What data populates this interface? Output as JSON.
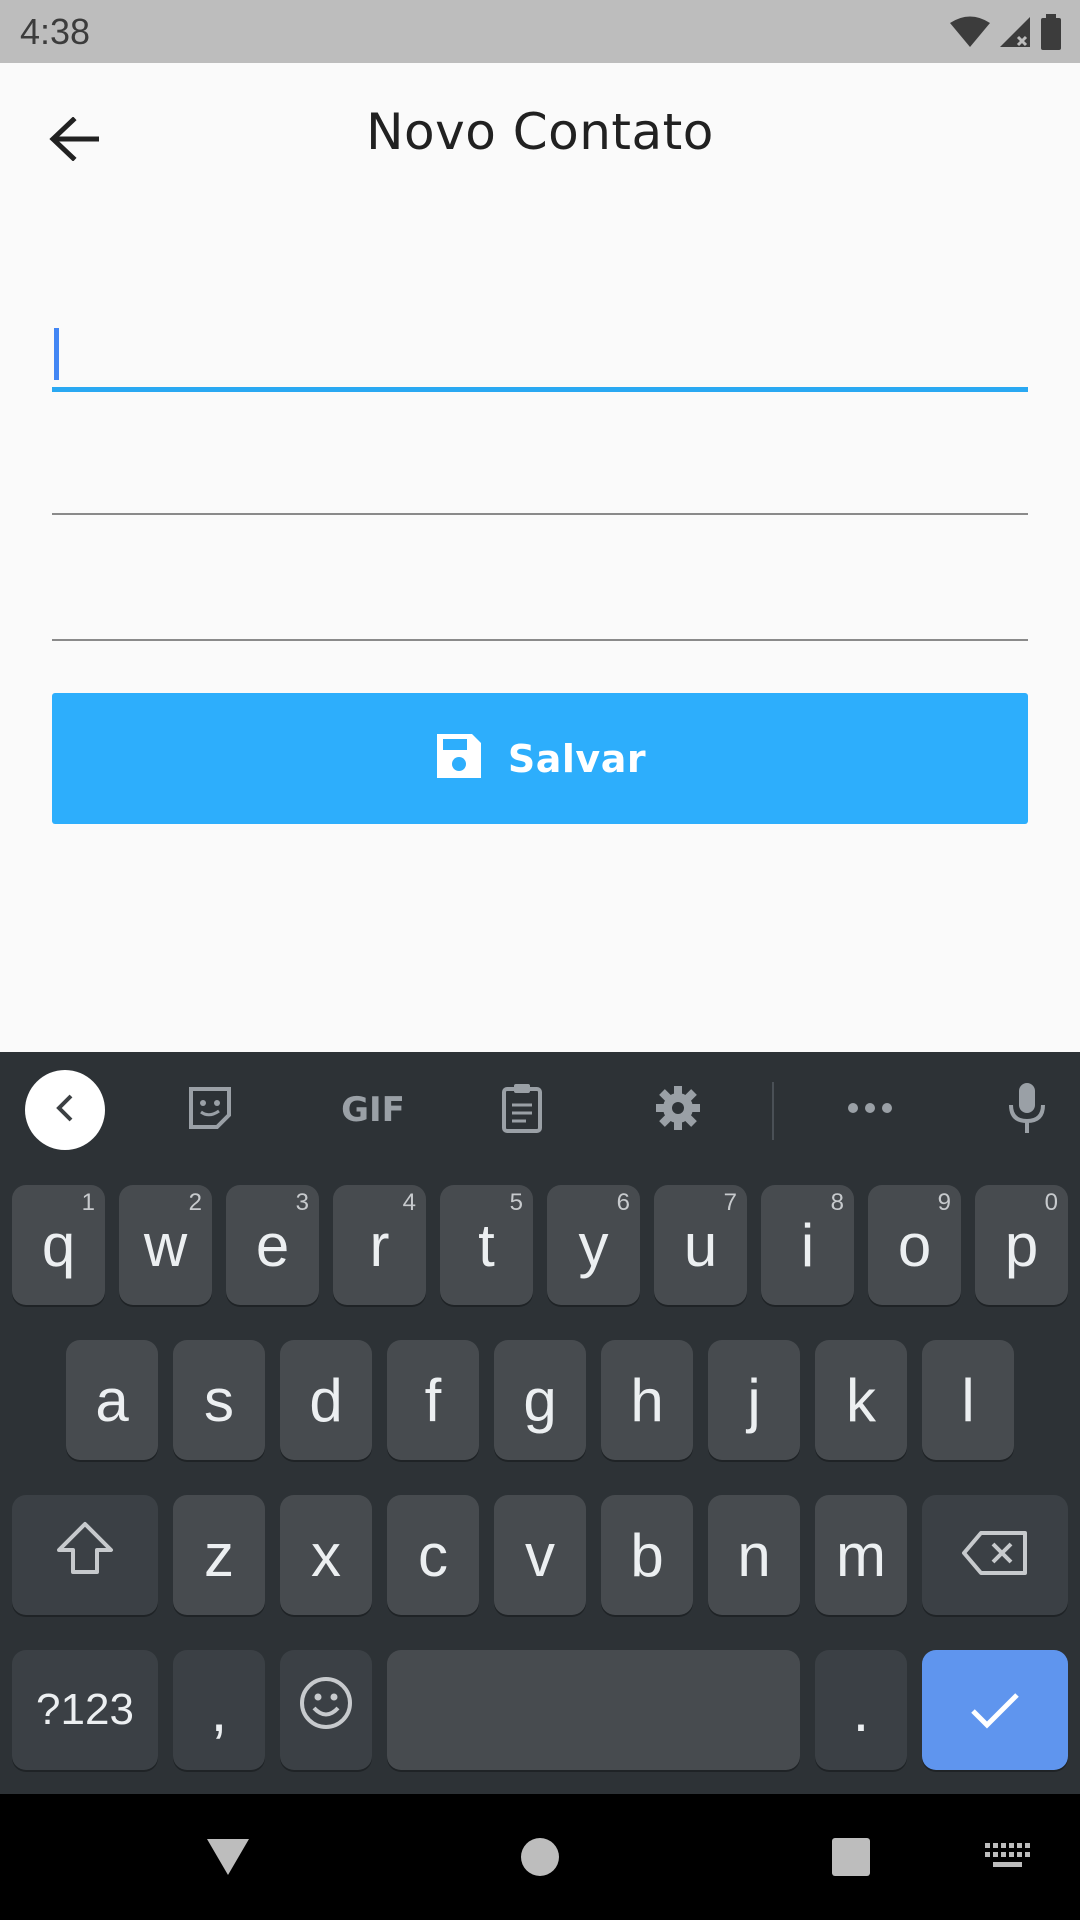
{
  "status_bar": {
    "time": "4:38",
    "icons": [
      "wifi-icon",
      "signal-icon",
      "battery-icon"
    ]
  },
  "app_bar": {
    "title": "Novo Contato",
    "back_icon": "arrow-back-icon"
  },
  "form": {
    "fields": [
      {
        "value": "",
        "placeholder": "",
        "focused": true
      },
      {
        "value": "",
        "placeholder": "",
        "focused": false
      },
      {
        "value": "",
        "placeholder": "",
        "focused": false
      }
    ],
    "save_button": {
      "label": "Salvar",
      "icon": "save-icon"
    }
  },
  "keyboard": {
    "toolbar": {
      "collapse_icon": "chevron-left-icon",
      "sticker_icon": "sticker-icon",
      "gif_label": "GIF",
      "clipboard_icon": "clipboard-icon",
      "settings_icon": "gear-icon",
      "more_icon": "more-icon",
      "mic_icon": "mic-icon"
    },
    "row1": [
      {
        "key": "q",
        "hint": "1"
      },
      {
        "key": "w",
        "hint": "2"
      },
      {
        "key": "e",
        "hint": "3"
      },
      {
        "key": "r",
        "hint": "4"
      },
      {
        "key": "t",
        "hint": "5"
      },
      {
        "key": "y",
        "hint": "6"
      },
      {
        "key": "u",
        "hint": "7"
      },
      {
        "key": "i",
        "hint": "8"
      },
      {
        "key": "o",
        "hint": "9"
      },
      {
        "key": "p",
        "hint": "0"
      }
    ],
    "row2": [
      "a",
      "s",
      "d",
      "f",
      "g",
      "h",
      "j",
      "k",
      "l"
    ],
    "row3": [
      "z",
      "x",
      "c",
      "v",
      "b",
      "n",
      "m"
    ],
    "symbols_label": "?123",
    "comma": ",",
    "period": ".",
    "colors": {
      "background": "#2d3236",
      "key": "#474b4f",
      "enter": "#5f95ee"
    }
  },
  "colors": {
    "accent": "#29a8f2",
    "button": "#2daefc"
  }
}
